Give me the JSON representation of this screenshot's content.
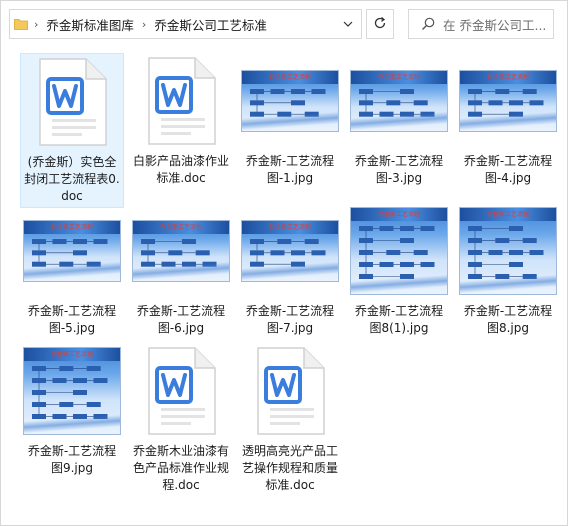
{
  "address_bar": {
    "crumbs": [
      "乔金斯标准图库",
      "乔金斯公司工艺标准"
    ]
  },
  "search": {
    "placeholder": "在 乔金斯公司工..."
  },
  "files": [
    {
      "name": "(乔金斯）实色全封闭工艺流程表0.doc",
      "type": "doc",
      "selected": true
    },
    {
      "name": "白影产品油漆作业标准.doc",
      "type": "doc"
    },
    {
      "name": "乔金斯-工艺流程图-1.jpg",
      "type": "jpg",
      "title": "乔金斯工艺流程"
    },
    {
      "name": "乔金斯-工艺流程图-3.jpg",
      "type": "jpg",
      "title": "乔金斯工艺流程"
    },
    {
      "name": "乔金斯-工艺流程图-4.jpg",
      "type": "jpg",
      "title": "乔金斯工艺流程"
    },
    {
      "name": "乔金斯-工艺流程图-5.jpg",
      "type": "jpg",
      "title": "乔金斯工艺流程"
    },
    {
      "name": "乔金斯-工艺流程图-6.jpg",
      "type": "jpg",
      "title": "乔金斯工艺流程"
    },
    {
      "name": "乔金斯-工艺流程图-7.jpg",
      "type": "jpg",
      "title": "乔金斯工艺流程"
    },
    {
      "name": "乔金斯-工艺流程图8(1).jpg",
      "type": "jpg",
      "title": "乔金斯工艺流程"
    },
    {
      "name": "乔金斯-工艺流程图8.jpg",
      "type": "jpg",
      "title": "乔金斯工艺流程"
    },
    {
      "name": "乔金斯-工艺流程图9.jpg",
      "type": "jpg",
      "title": "乔金斯工艺流程"
    },
    {
      "name": "乔金斯木业油漆有色产品标准作业规程.doc",
      "type": "doc"
    },
    {
      "name": "透明高亮光产品工艺操作规程和质量标准.doc",
      "type": "doc"
    }
  ],
  "colors": {
    "word_blue": "#3b7ddd",
    "selection_bg": "#e5f3ff",
    "selection_border": "#cce8ff"
  }
}
